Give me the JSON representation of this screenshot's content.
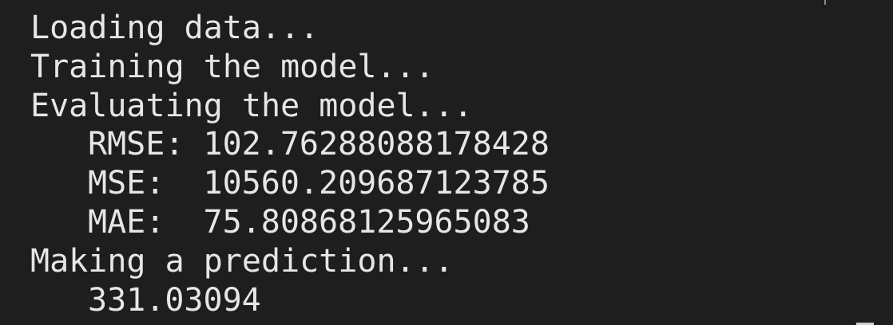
{
  "terminal": {
    "lines": [
      {
        "text": "Loading data..."
      },
      {
        "text": "Training the model..."
      },
      {
        "text": "Evaluating the model..."
      },
      {
        "text": "RMSE: 102.76288088178428"
      },
      {
        "text": "MSE:  10560.209687123785"
      },
      {
        "text": "MAE:  75.80868125965083"
      },
      {
        "text": "Making a prediction..."
      },
      {
        "text": "331.03094"
      }
    ]
  }
}
